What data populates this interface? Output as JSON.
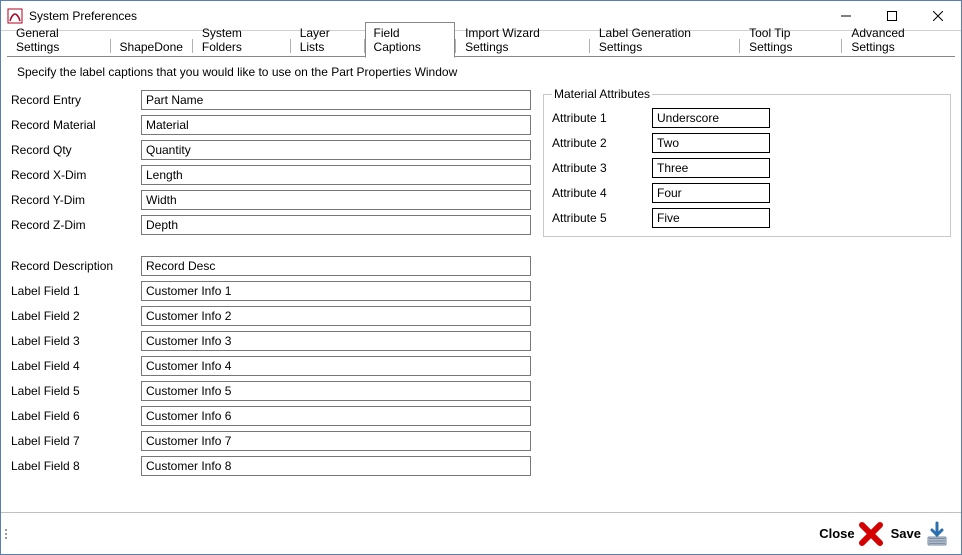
{
  "window": {
    "title": "System Preferences"
  },
  "tabs": [
    {
      "label": "General Settings"
    },
    {
      "label": "ShapeDone"
    },
    {
      "label": "System Folders"
    },
    {
      "label": "Layer Lists"
    },
    {
      "label": "Field Captions"
    },
    {
      "label": "Import Wizard Settings"
    },
    {
      "label": "Label Generation Settings"
    },
    {
      "label": "Tool Tip Settings"
    },
    {
      "label": "Advanced Settings"
    }
  ],
  "active_tab_index": 4,
  "description": "Specify the label captions that you would like to use on the Part Properties Window",
  "fields_group1": [
    {
      "label": "Record Entry",
      "value": "Part Name"
    },
    {
      "label": "Record Material",
      "value": "Material"
    },
    {
      "label": "Record Qty",
      "value": "Quantity"
    },
    {
      "label": "Record X-Dim",
      "value": "Length"
    },
    {
      "label": "Record Y-Dim",
      "value": "Width"
    },
    {
      "label": "Record Z-Dim",
      "value": "Depth"
    }
  ],
  "fields_group2": [
    {
      "label": "Record Description",
      "value": "Record Desc"
    },
    {
      "label": "Label Field 1",
      "value": "Customer Info 1"
    },
    {
      "label": "Label Field 2",
      "value": "Customer Info 2"
    },
    {
      "label": "Label Field 3",
      "value": "Customer Info 3"
    },
    {
      "label": "Label Field 4",
      "value": "Customer Info 4"
    },
    {
      "label": "Label Field 5",
      "value": "Customer Info 5"
    },
    {
      "label": "Label Field 6",
      "value": "Customer Info 6"
    },
    {
      "label": "Label Field 7",
      "value": "Customer Info 7"
    },
    {
      "label": "Label Field 8",
      "value": "Customer Info 8"
    }
  ],
  "attributes": {
    "legend": "Material Attributes",
    "items": [
      {
        "label": "Attribute 1",
        "value": "Underscore"
      },
      {
        "label": "Attribute 2",
        "value": "Two"
      },
      {
        "label": "Attribute 3",
        "value": "Three"
      },
      {
        "label": "Attribute 4",
        "value": "Four"
      },
      {
        "label": "Attribute 5",
        "value": "Five"
      }
    ]
  },
  "footer": {
    "close": "Close",
    "save": "Save"
  }
}
